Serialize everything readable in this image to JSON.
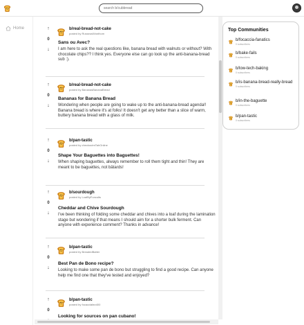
{
  "search": {
    "placeholder": "search b/cubbread"
  },
  "nav": {
    "home_label": "Home"
  },
  "posts": [
    {
      "community": "b/real-bread-not-cake",
      "posted_by": "posted by RusseusWonthom",
      "votes": "0",
      "title": "Sans ou Avec?",
      "body": "I am here to ask the real questions like, banana bread with walnuts or without? With chocolate chips?? I think yes. Everyone else can go look up the anti-banana-bread sub :)."
    },
    {
      "community": "b/real-bread-not-cake",
      "posted_by": "posted by BananasBananaBread",
      "votes": "0",
      "title": "Bananas for Banana Bread",
      "body": "Wondering when people are going to wake up to the anti-banana-bread agenda!! Banana bread is where it's at folks! It doesn't get any better than a slice of warm, buttery banana bread with a glass of milk."
    },
    {
      "community": "b/pan-tastic",
      "posted_by": "posted by checkoutmTahOnline",
      "votes": "0",
      "title": "Shape Your Baguettes into Baguettes!",
      "body": "When shaping baguettes, always remember to roll them tight and thin! They are meant to be baguettes, not bâtards!"
    },
    {
      "community": "b/sourdough",
      "posted_by": "posted by LoafByFuncults",
      "votes": "0",
      "title": "Cheddar and Chive Sourdough",
      "body": "I've been thinking of folding some cheddar and chives into a loaf during the lamination stage but wondering if that means I should aim for a shorter bulk ferment. Can anyone with experience comment? Thanks in advance!"
    },
    {
      "community": "b/pan-tastic",
      "posted_by": "posted by BreadedBatter",
      "votes": "0",
      "title": "Best Pan de Bono recipe?",
      "body": "Looking to make some pan de bono but struggling to find a good recipe. Can anyone help me find one that they've tested and enjoyed?"
    },
    {
      "community": "b/pan-tastic",
      "posted_by": "posted by focacciafan400",
      "votes": "0",
      "title": "Looking for sources on pan cubano!",
      "body": ""
    }
  ],
  "top_communities": {
    "title": "Top Communities",
    "items": [
      {
        "name": "b/focaccia-fanatics",
        "sub": "0 subscribers"
      },
      {
        "name": "b/bake-fails",
        "sub": "0 subscribers"
      },
      {
        "name": "b/low-tech-baking",
        "sub": "0 subscribers"
      },
      {
        "name": "b/is-banana-bread-really-bread",
        "sub": "0 subscribers"
      },
      {
        "name": "b/in-the-baguette",
        "sub": "0 subscribers"
      },
      {
        "name": "b/pan-tastic",
        "sub": "0 subscribers"
      }
    ]
  },
  "colors": {
    "accent": "#f4a51c",
    "bread_crust": "#c97a12",
    "bread_crumb": "#f7c24a"
  }
}
